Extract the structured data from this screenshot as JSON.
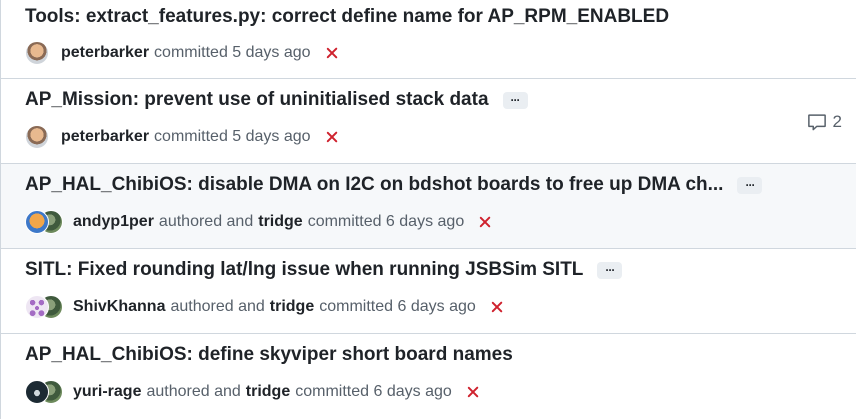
{
  "commits": [
    {
      "title": "Tools: extract_features.py: correct define name for AP_RPM_ENABLED",
      "has_ellipsis": false,
      "author": "peterbarker",
      "author_avatar": "peterbarker-avatar",
      "committer": "",
      "action": "committed 5 days ago",
      "status": "failure",
      "comments": ""
    },
    {
      "title": "AP_Mission: prevent use of uninitialised stack data",
      "has_ellipsis": true,
      "author": "peterbarker",
      "author_avatar": "peterbarker-avatar",
      "committer": "",
      "action": "committed 5 days ago",
      "status": "failure",
      "comments": "2"
    },
    {
      "title": "AP_HAL_ChibiOS: disable DMA on I2C on bdshot boards to free up DMA ch...",
      "has_ellipsis": true,
      "author": "andyp1per",
      "author_avatar": "andyp1per-avatar",
      "authored_text": "authored and",
      "committer": "tridge",
      "action": "committed 6 days ago",
      "status": "failure",
      "comments": ""
    },
    {
      "title": "SITL: Fixed rounding lat/lng issue when running JSBSim SITL",
      "has_ellipsis": true,
      "author": "ShivKhanna",
      "author_avatar": "shivkhanna-avatar",
      "authored_text": "authored and",
      "committer": "tridge",
      "action": "committed 6 days ago",
      "status": "failure",
      "comments": ""
    },
    {
      "title": "AP_HAL_ChibiOS: define skyviper short board names",
      "has_ellipsis": false,
      "author": "yuri-rage",
      "author_avatar": "yuri-rage-avatar",
      "authored_text": "authored and",
      "committer": "tridge",
      "action": "committed 6 days ago",
      "status": "failure",
      "comments": ""
    }
  ],
  "ellipsis_label": "···",
  "colors": {
    "failure": "#cf222e",
    "muted": "#57606a",
    "border": "#d0d7de",
    "hover_row": "#f6f8fa"
  }
}
